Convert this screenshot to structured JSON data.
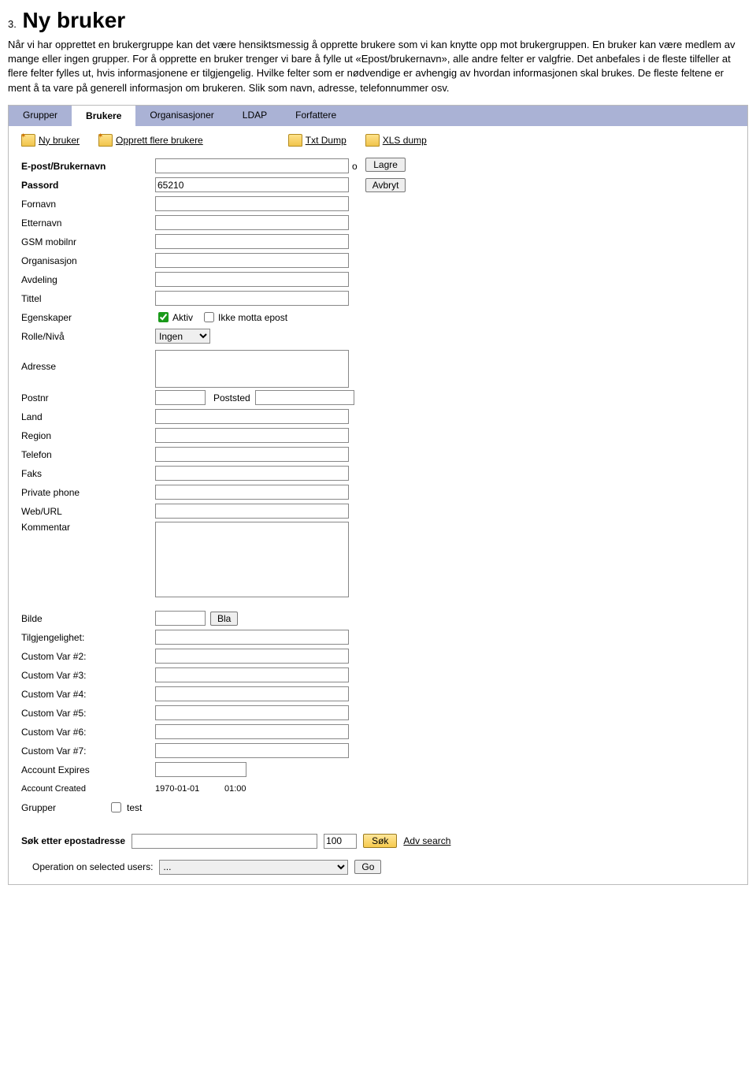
{
  "intro": {
    "num": "3.",
    "title": "Ny bruker",
    "text": "Når vi har opprettet en brukergruppe kan det være hensiktsmessig å opprette brukere som vi kan knytte opp mot brukergruppen. En bruker kan være medlem av mange eller ingen grupper. For å opprette en bruker trenger vi bare å fylle ut «Epost/brukernavn», alle andre felter er valgfrie. Det anbefales i de fleste tilfeller at flere felter fylles ut, hvis informasjonene er tilgjengelig. Hvilke felter som er nødvendige er avhengig av hvordan informasjonen skal brukes. De fleste feltene er ment å ta vare på generell informasjon om brukeren. Slik som navn, adresse, telefonnummer osv."
  },
  "tabs": {
    "grupper": "Grupper",
    "brukere": "Brukere",
    "organisasjoner": "Organisasjoner",
    "ldap": "LDAP",
    "forfattere": "Forfattere"
  },
  "toolbar": {
    "ny_bruker": "Ny bruker",
    "opprett_flere": "Opprett flere brukere",
    "txt_dump": "Txt Dump",
    "xls_dump": "XLS dump"
  },
  "labels": {
    "epost": "E-post/Brukernavn",
    "passord": "Passord",
    "fornavn": "Fornavn",
    "etternavn": "Etternavn",
    "gsm": "GSM mobilnr",
    "organisasjon": "Organisasjon",
    "avdeling": "Avdeling",
    "tittel": "Tittel",
    "egenskaper": "Egenskaper",
    "aktiv": "Aktiv",
    "ikke_motta": "Ikke motta epost",
    "rolle": "Rolle/Nivå",
    "adresse": "Adresse",
    "postnr": "Postnr",
    "poststed": "Poststed",
    "land": "Land",
    "region": "Region",
    "telefon": "Telefon",
    "faks": "Faks",
    "privphone": "Private phone",
    "weburl": "Web/URL",
    "kommentar": "Kommentar",
    "bilde": "Bilde",
    "tilgj": "Tilgjengelighet:",
    "cv2": "Custom Var #2:",
    "cv3": "Custom Var #3:",
    "cv4": "Custom Var #4:",
    "cv5": "Custom Var #5:",
    "cv6": "Custom Var #6:",
    "cv7": "Custom Var #7:",
    "acc_exp": "Account Expires",
    "acc_created": "Account Created",
    "grupper": "Grupper"
  },
  "values": {
    "passord": "65210",
    "rolle": "Ingen",
    "created_date": "1970-01-01",
    "created_time": "01:00",
    "grupper_test": "test",
    "mystery_o": "o"
  },
  "buttons": {
    "lagre": "Lagre",
    "avbryt": "Avbryt",
    "bla": "Bla",
    "sok": "Søk",
    "go": "Go"
  },
  "search": {
    "label": "Søk etter epostadresse",
    "limit": "100",
    "adv": "Adv search"
  },
  "ops": {
    "label": "Operation on selected users:",
    "sel": "..."
  }
}
